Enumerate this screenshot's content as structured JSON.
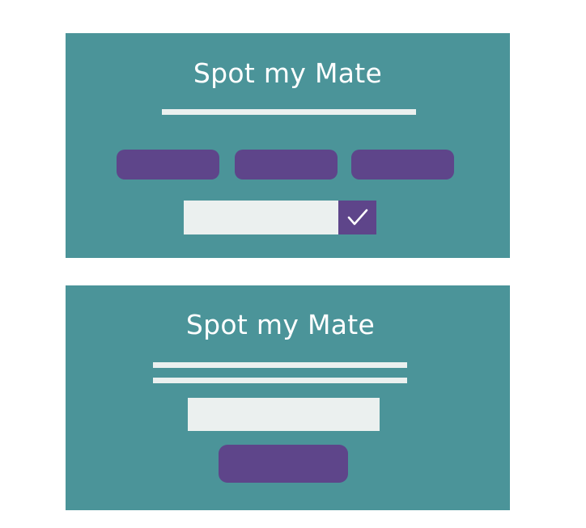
{
  "screens": [
    {
      "title": "Spot my Mate",
      "choice_buttons": [
        "",
        "",
        ""
      ],
      "input": {
        "value": "",
        "placeholder": ""
      },
      "confirm_icon": "checkmark-icon"
    },
    {
      "title": "Spot my Mate",
      "input": {
        "value": "",
        "placeholder": ""
      },
      "action_button_label": ""
    }
  ],
  "colors": {
    "panel": "#4b9499",
    "accent": "#5e458a",
    "light": "#ebf0ef",
    "text": "#ffffff"
  }
}
